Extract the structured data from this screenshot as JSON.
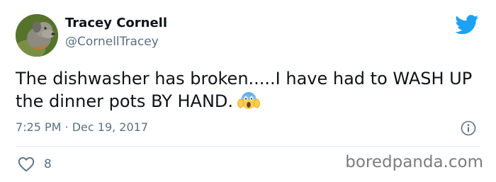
{
  "tweet": {
    "display_name": "Tracey Cornell",
    "handle": "@CornellTracey",
    "text": "The dishwasher has broken.....I have had to WASH UP the dinner pots BY HAND.",
    "emoji": "face-screaming-in-fear",
    "timestamp": "7:25 PM · Dec 19, 2017",
    "like_count": "8"
  },
  "icons": {
    "brand": "twitter-bird-icon",
    "info": "info-icon",
    "like": "heart-icon"
  },
  "colors": {
    "twitter_blue": "#1da1f2",
    "secondary_text": "#5b7083",
    "primary_text": "#0f1419"
  },
  "watermark": "boredpanda.com"
}
